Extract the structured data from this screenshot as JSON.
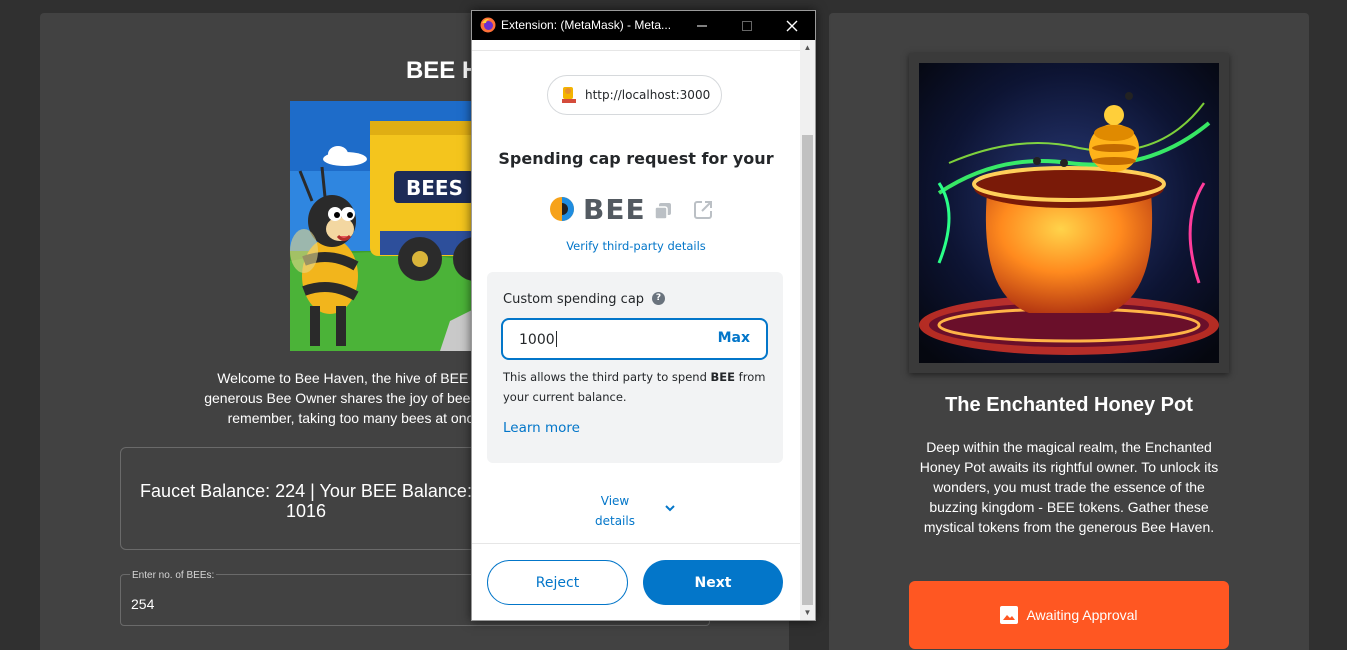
{
  "app": {
    "title": "BEE Haven",
    "welcome_text": "Welcome to Bee Haven, the hive of BEE tokens! Im\ngenerous Bee Owner shares the joy of bees with you. E\nremember, taking too many bees at once may di",
    "balance_text": "Faucet Balance: 224 | Your BEE Balance:\n1016",
    "bee_input": {
      "label": "Enter no. of BEEs:",
      "value": "254"
    }
  },
  "nft": {
    "title": "The Enchanted Honey Pot",
    "description": "Deep within the magical realm, the Enchanted Honey Pot awaits its rightful owner. To unlock its wonders, you must trade the essence of the buzzing kingdom - BEE tokens. Gather these mystical tokens from the generous Bee Haven.",
    "button_label": "Awaiting Approval"
  },
  "hero_image": {
    "sign_text": "BEES"
  },
  "popup": {
    "window_title": "Extension: (MetaMask) - Meta...",
    "origin": "http://localhost:3000",
    "heading": "Spending cap request for your",
    "token": "BEE",
    "verify_link": "Verify third-party details",
    "cap_label": "Custom spending cap",
    "cap_value": "1000",
    "max_label": "Max",
    "note_prefix": "This allows the third party to spend ",
    "note_token": "BEE",
    "note_suffix": " from your current balance.",
    "learn_more": "Learn more",
    "view_details": "View details",
    "reject_label": "Reject",
    "next_label": "Next"
  },
  "colors": {
    "accent_blue": "#0376c9",
    "approval_orange": "#ff5722",
    "panel_bg": "#424242",
    "page_bg": "#303030"
  },
  "icons": [
    "firefox-icon",
    "minimize-icon",
    "maximize-icon",
    "close-icon",
    "origin-favicon-icon",
    "token-logo-icon",
    "copy-icon",
    "external-link-icon",
    "help-icon",
    "chevron-down-icon",
    "image-icon",
    "scroll-up-icon",
    "scroll-down-icon"
  ]
}
